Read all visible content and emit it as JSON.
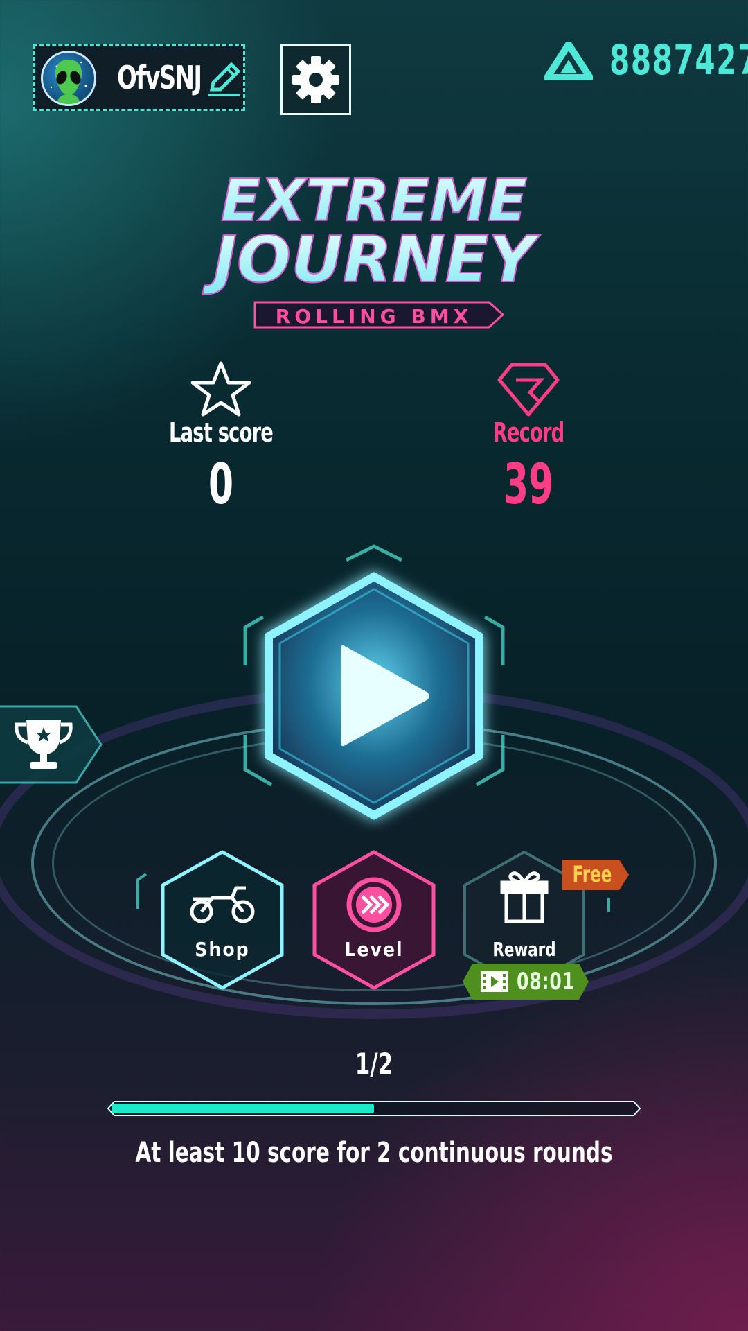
{
  "player": {
    "name": "OfvSNJ",
    "avatar_icon": "alien-avatar-icon",
    "edit_icon": "pencil-icon"
  },
  "settings": {
    "icon": "gear-icon"
  },
  "currency": {
    "amount": "8887427",
    "icon": "triangle-gem-icon",
    "color": "#4ee8d8"
  },
  "logo": {
    "line1": "EXTREME",
    "line2": "JOURNEY",
    "subtitle": "ROLLING BMX"
  },
  "last_score": {
    "label": "Last score",
    "value": "0",
    "icon": "star-icon"
  },
  "record": {
    "label": "Record",
    "value": "39",
    "icon": "diamond-icon",
    "color": "#ff3d86"
  },
  "play": {
    "icon": "play-icon"
  },
  "leaderboard": {
    "icon": "trophy-icon"
  },
  "menu": {
    "shop": {
      "label": "Shop",
      "icon": "motorcycle-icon"
    },
    "level": {
      "label": "Level",
      "icon": "fast-forward-icon"
    },
    "reward": {
      "label": "Reward",
      "icon": "gift-icon",
      "badge": "Free",
      "timer": "08:01",
      "timer_icon": "video-icon"
    }
  },
  "mission": {
    "progress_text": "1/2",
    "progress": 0.5,
    "description": "At least 10 score for 2 continuous rounds"
  }
}
